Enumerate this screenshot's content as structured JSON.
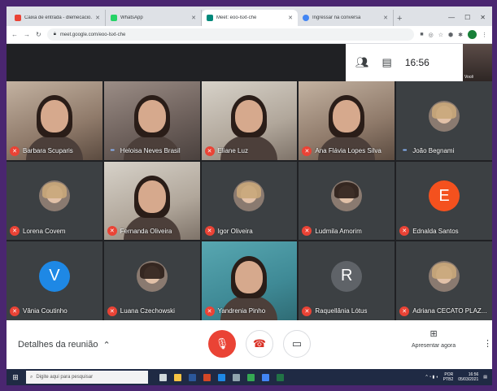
{
  "browser": {
    "tabs": [
      {
        "label": "Caixa de entrada - dlemecacio...",
        "color": "#ea4335",
        "active": false
      },
      {
        "label": "WhatsApp",
        "color": "#25d366",
        "active": false
      },
      {
        "label": "Meet: eoo-lsxt-che",
        "color": "#00897b",
        "active": true
      },
      {
        "label": "Ingressar na conversa",
        "color": "#4285f4",
        "active": false
      }
    ],
    "url": "meet.google.com/eoo-lsxt-che"
  },
  "top": {
    "clock": "16:56",
    "self_label": "Você"
  },
  "participants": [
    {
      "name": "Barbara Scuparis",
      "kind": "video",
      "tone": "warm",
      "status": "muted"
    },
    {
      "name": "Heloisa Neves Brasil",
      "kind": "video",
      "tone": "",
      "status": "speaking"
    },
    {
      "name": "Eliane Luz",
      "kind": "video",
      "tone": "room",
      "status": "muted"
    },
    {
      "name": "Ana Flávia Lopes Silva",
      "kind": "video",
      "tone": "warm",
      "status": "muted"
    },
    {
      "name": "João Begnami",
      "kind": "avatar",
      "avatar": "photo",
      "status": "speaking"
    },
    {
      "name": "Lorena Covem",
      "kind": "avatar",
      "avatar": "photo",
      "status": "muted"
    },
    {
      "name": "Fernanda Oliveira",
      "kind": "video",
      "tone": "room",
      "status": "muted"
    },
    {
      "name": "Igor Oliveira",
      "kind": "avatar",
      "avatar": "photo",
      "status": "muted"
    },
    {
      "name": "Ludmila Amorim",
      "kind": "avatar",
      "avatar": "photo dark",
      "status": "muted"
    },
    {
      "name": "Ednalda Santos",
      "kind": "letter",
      "letter": "E",
      "color": "#f4511e",
      "status": "muted"
    },
    {
      "name": "Vânia Coutinho",
      "kind": "letter",
      "letter": "V",
      "color": "#1e88e5",
      "status": "muted"
    },
    {
      "name": "Luana Czechowski",
      "kind": "avatar",
      "avatar": "photo dark",
      "status": "muted"
    },
    {
      "name": "Yandrenia Pinho",
      "kind": "video",
      "tone": "teal",
      "status": "muted"
    },
    {
      "name": "Raquellânia Lótus",
      "kind": "letter",
      "letter": "R",
      "color": "#5f6368",
      "status": "muted"
    },
    {
      "name": "Adriana CECATO PLAZ...",
      "kind": "avatar",
      "avatar": "photo",
      "status": "muted"
    }
  ],
  "bottom": {
    "details_label": "Detalhes da reunião",
    "present_label": "Apresentar agora"
  },
  "taskbar": {
    "search_placeholder": "Digite aqui para pesquisar",
    "tray_lang": "POR",
    "tray_lang2": "PTB2",
    "tray_time": "16:56",
    "tray_date": "05/03/2021"
  },
  "colors": {
    "accent_red": "#ea4335",
    "meet_bg": "#202124"
  }
}
